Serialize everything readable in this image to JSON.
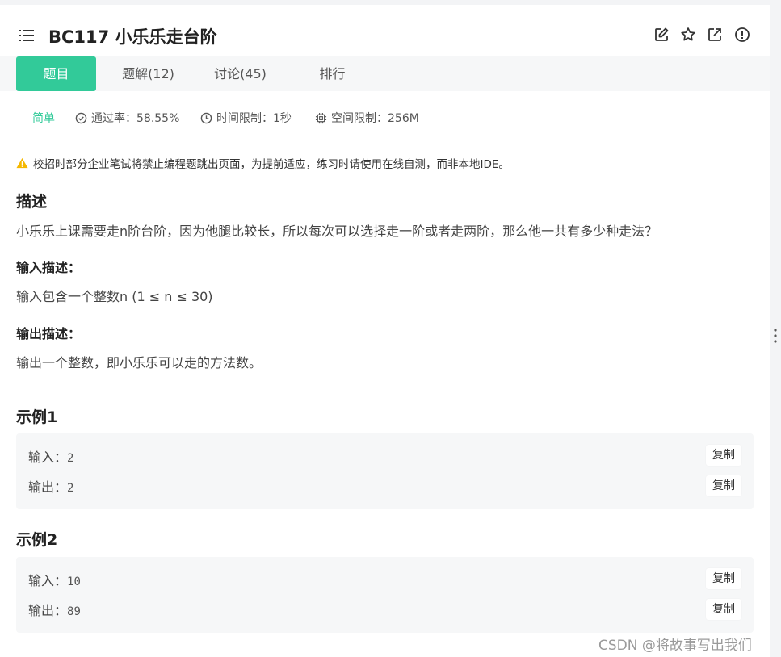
{
  "header": {
    "title": "BC117  小乐乐走台阶",
    "icons": [
      "edit-icon",
      "star-icon",
      "external-link-icon",
      "info-icon"
    ]
  },
  "tabs": [
    {
      "label": "题目",
      "active": true
    },
    {
      "label": "题解(12)",
      "active": false
    },
    {
      "label": "讨论(45)",
      "active": false
    },
    {
      "label": "排行",
      "active": false
    }
  ],
  "meta": {
    "difficulty": "简单",
    "pass_rate": "通过率：58.55%",
    "time_limit": "时间限制：1秒",
    "memory_limit": "空间限制：256M"
  },
  "warning": "校招时部分企业笔试将禁止编程题跳出页面，为提前适应，练习时请使用在线自测，而非本地IDE。",
  "description": {
    "heading": "描述",
    "text": "小乐乐上课需要走n阶台阶，因为他腿比较长，所以每次可以选择走一阶或者走两阶，那么他一共有多少种走法？",
    "input_heading": "输入描述：",
    "input_text": "输入包含一个整数n (1 ≤ n ≤ 30)",
    "output_heading": "输出描述：",
    "output_text": "输出一个整数，即小乐乐可以走的方法数。"
  },
  "examples": [
    {
      "heading": "示例1",
      "input_label": "输入：",
      "input": "2",
      "output_label": "输出：",
      "output": "2",
      "copy_label": "复制"
    },
    {
      "heading": "示例2",
      "input_label": "输入：",
      "input": "10",
      "output_label": "输出：",
      "output": "89",
      "copy_label": "复制"
    }
  ],
  "watermark": "CSDN @将故事写出我们",
  "colors": {
    "accent": "#32ca99",
    "warning": "#f5b800"
  }
}
